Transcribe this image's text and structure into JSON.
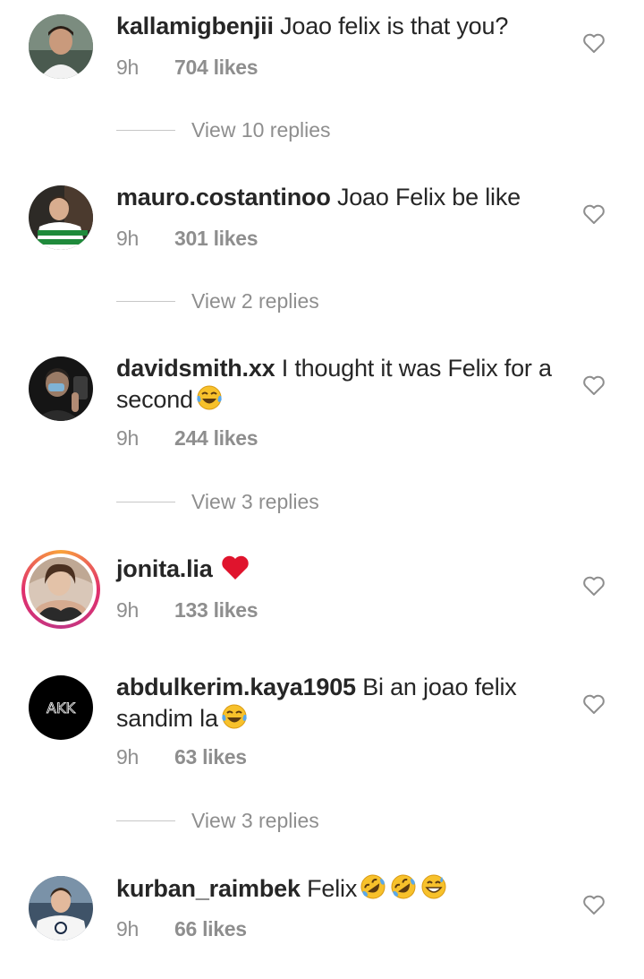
{
  "comments": [
    {
      "username": "kallamigbenjii",
      "text": "Joao felix is that you?",
      "time": "9h",
      "likes": "704 likes",
      "replies_label": "View 10 replies",
      "avatar": "profile-photo-man"
    },
    {
      "username": "mauro.costantinoo",
      "text": "Joao Felix be like",
      "time": "9h",
      "likes": "301 likes",
      "replies_label": "View 2 replies",
      "avatar": "profile-photo-green-striped-shirt"
    },
    {
      "username": "davidsmith.xx",
      "text": "I thought it was Felix for a second",
      "emojis": [
        "tears-of-joy-emoji"
      ],
      "time": "9h",
      "likes": "244 likes",
      "replies_label": "View 3 replies",
      "avatar": "profile-photo-dark"
    },
    {
      "username": "jonita.lia",
      "text": "",
      "emojis": [
        "red-heart-emoji"
      ],
      "time": "9h",
      "likes": "133 likes",
      "avatar": "profile-photo-story-ring"
    },
    {
      "username": "abdulkerim.kaya1905",
      "text": "Bi an joao felix sandim la",
      "emojis": [
        "tears-of-joy-emoji"
      ],
      "time": "9h",
      "likes": "63 likes",
      "replies_label": "View 3 replies",
      "avatar_text": "AKK"
    },
    {
      "username": "kurban_raimbek",
      "text": "Felix",
      "emojis": [
        "rolling-on-floor-laughing-emoji",
        "rolling-on-floor-laughing-emoji",
        "grinning-sweat-emoji"
      ],
      "time": "9h",
      "likes": "66 likes",
      "avatar": "profile-photo-white-jersey"
    }
  ],
  "colors": {
    "text": "#262626",
    "secondary": "#8e8e8e",
    "divider": "#c7c7c7",
    "heart_red": "#e0142d",
    "emoji_yellow": "#f7c12b"
  },
  "icons": {
    "like": "heart-outline-icon"
  }
}
